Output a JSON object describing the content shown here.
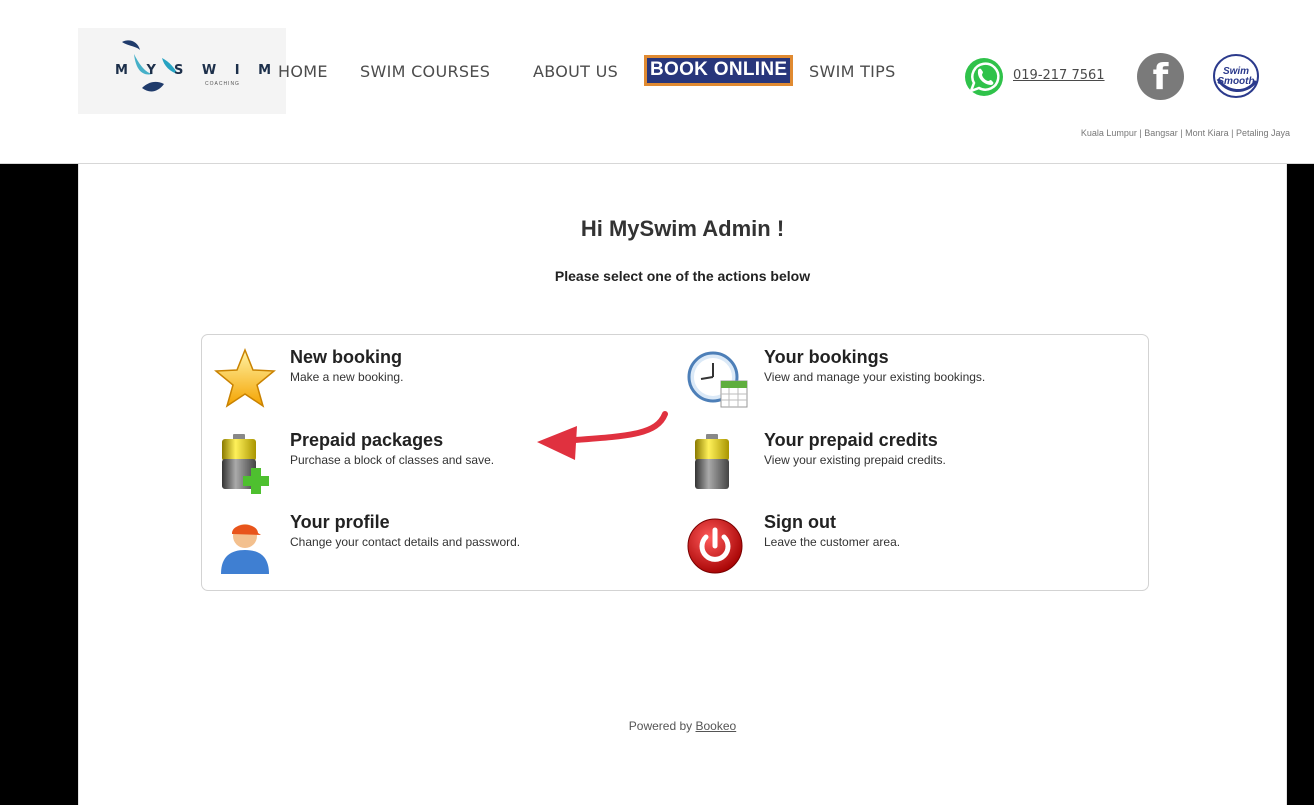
{
  "header": {
    "logo": {
      "text": "MYSWIM",
      "subtext": "COACHING"
    },
    "nav": [
      {
        "label": "HOME"
      },
      {
        "label": "SWIM COURSES"
      },
      {
        "label": "ABOUT US"
      },
      {
        "label": "BOOK ONLINE"
      },
      {
        "label": "SWIM TIPS"
      }
    ],
    "phone": "019-217 7561",
    "social_icons": [
      "whatsapp-icon",
      "facebook-icon",
      "swim-smooth-icon"
    ],
    "swim_smooth_text": "Swim Smooth",
    "locations": "Kuala Lumpur | Bangsar | Mont Kiara | Petaling Jaya"
  },
  "content": {
    "greeting": "Hi MySwim Admin !",
    "subtitle": "Please select one of the actions below",
    "actions": [
      {
        "title": "New booking",
        "desc": "Make a new booking.",
        "icon": "star-icon"
      },
      {
        "title": "Your bookings",
        "desc": "View and manage your existing bookings.",
        "icon": "clock-calendar-icon"
      },
      {
        "title": "Prepaid packages",
        "desc": "Purchase a block of classes and save.",
        "icon": "battery-plus-icon"
      },
      {
        "title": "Your prepaid credits",
        "desc": "View your existing prepaid credits.",
        "icon": "battery-icon"
      },
      {
        "title": "Your profile",
        "desc": "Change your contact details and password.",
        "icon": "user-icon"
      },
      {
        "title": "Sign out",
        "desc": "Leave the customer area.",
        "icon": "power-icon"
      }
    ],
    "powered_by": "Powered by",
    "powered_link": "Bookeo"
  },
  "colors": {
    "book_online_bg": "#28367b",
    "book_online_border": "#e08a31",
    "annotation_arrow": "#e0313f",
    "whatsapp": "#2fc24a",
    "facebook": "#7a7a7a"
  }
}
